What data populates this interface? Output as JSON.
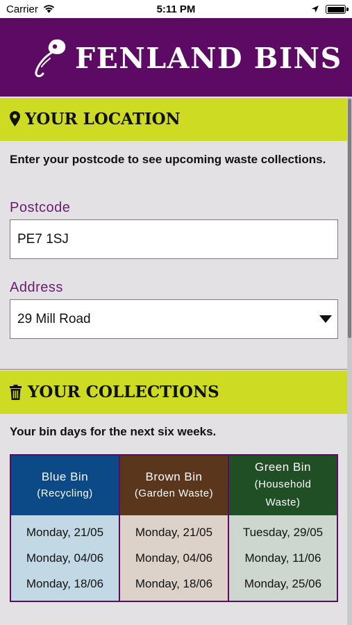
{
  "status_bar": {
    "carrier": "Carrier",
    "time": "5:11 PM"
  },
  "header": {
    "title": "FENLAND BINS",
    "logo_icon": "bin-tag-logo"
  },
  "location": {
    "heading": "YOUR LOCATION",
    "icon": "map-pin-icon",
    "intro": "Enter your postcode to see upcoming waste collections.",
    "postcode_label": "Postcode",
    "postcode_value": "PE7 1SJ",
    "address_label": "Address",
    "address_value": "29 Mill Road"
  },
  "collections": {
    "heading": "YOUR COLLECTIONS",
    "icon": "trash-icon",
    "intro": "Your bin days for the next six weeks.",
    "bins": [
      {
        "name": "Blue Bin",
        "sub": "(Recycling)",
        "head_color": "#0c4a87",
        "body_color": "#c3d8e5",
        "dates": [
          "Monday, 21/05",
          "Monday, 04/06",
          "Monday, 18/06"
        ]
      },
      {
        "name": "Brown Bin",
        "sub": "(Garden Waste)",
        "head_color": "#5a361c",
        "body_color": "#dcd2c9",
        "dates": [
          "Monday, 21/05",
          "Monday, 04/06",
          "Monday, 18/06"
        ]
      },
      {
        "name": "Green Bin",
        "sub": "(Household Waste)",
        "head_color": "#204f25",
        "body_color": "#cdd7cf",
        "dates": [
          "Tuesday, 29/05",
          "Monday, 11/06",
          "Monday, 25/06"
        ]
      }
    ]
  }
}
